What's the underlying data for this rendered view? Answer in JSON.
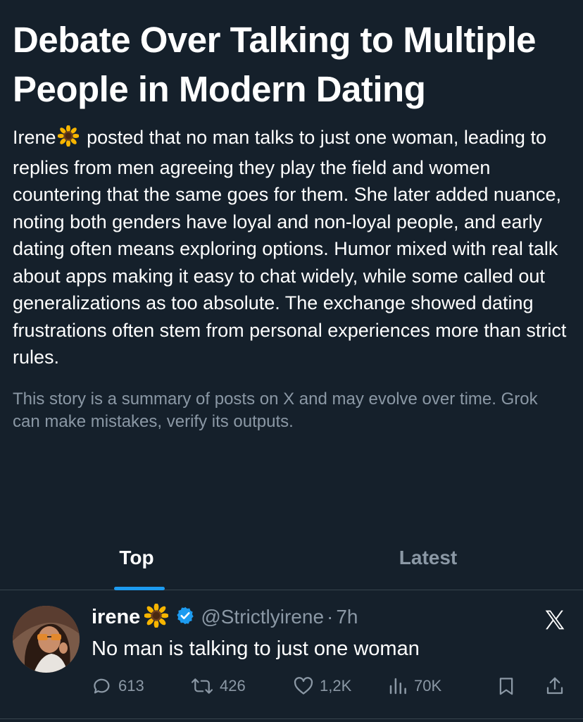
{
  "story": {
    "headline": "Debate Over Talking to Multiple People in Modern Dating",
    "summary_author": "Irene",
    "summary_author_emoji": "sunflower-emoji",
    "summary_body": "posted that no man talks to just one woman, leading to replies from men agreeing they play the field and women countering that the same goes for them. She later added nuance, noting both genders have loyal and non-loyal people, and early dating often means exploring options. Humor mixed with real talk about apps making it easy to chat widely, while some called out generalizations as too absolute. The exchange showed dating frustrations often stem from personal experiences more than strict rules.",
    "disclaimer": "This story is a summary of posts on X and may evolve over time. Grok can make mistakes, verify its outputs."
  },
  "tabs": [
    {
      "label": "Top",
      "active": true
    },
    {
      "label": "Latest",
      "active": false
    }
  ],
  "tweet": {
    "name": "irene",
    "name_emoji": "sunflower-emoji",
    "verified": true,
    "handle": "@Strictlyirene",
    "separator": "·",
    "time": "7h",
    "text": "No man is talking to just one woman",
    "replies": "613",
    "reposts": "426",
    "likes": "1,2K",
    "views": "70K",
    "icons": {
      "reply": "reply-icon",
      "repost": "repost-icon",
      "like": "heart-icon",
      "views": "views-icon",
      "bookmark": "bookmark-icon",
      "share": "share-icon",
      "source": "x-logo-icon"
    }
  },
  "colors": {
    "background": "#15202b",
    "text_primary": "#ffffff",
    "text_secondary": "#8b98a5",
    "accent": "#1d9bf0",
    "divider": "#38444d"
  }
}
